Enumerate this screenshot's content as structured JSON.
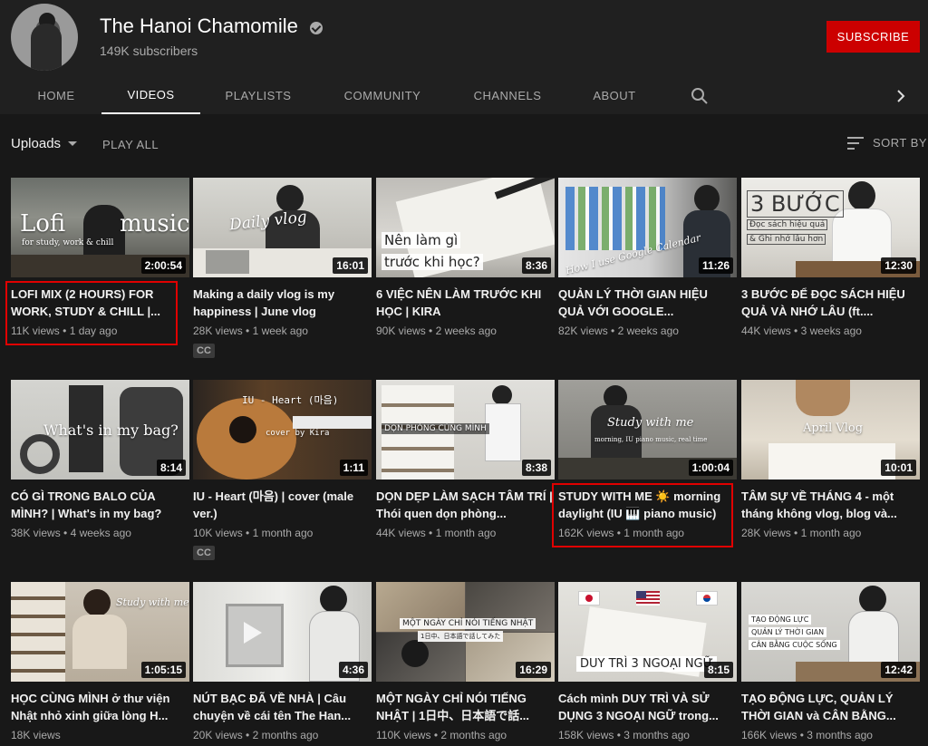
{
  "channel": {
    "name": "The Hanoi Chamomile",
    "subscribers": "149K subscribers",
    "subscribe_label": "SUBSCRIBE"
  },
  "tabs": [
    {
      "label": "HOME",
      "active": false
    },
    {
      "label": "VIDEOS",
      "active": true
    },
    {
      "label": "PLAYLISTS",
      "active": false
    },
    {
      "label": "COMMUNITY",
      "active": false
    },
    {
      "label": "CHANNELS",
      "active": false
    },
    {
      "label": "ABOUT",
      "active": false
    }
  ],
  "toolbar": {
    "uploads_label": "Uploads",
    "play_all_label": "PLAY ALL",
    "sort_label": "SORT BY"
  },
  "colors": {
    "subscribe_red": "#cc0000",
    "highlight_red": "#e00000",
    "background": "#181818"
  },
  "thumb_texts": {
    "v0": [
      "Lofi",
      "music",
      "for study, work & chill"
    ],
    "v1": [
      "Daily vlog"
    ],
    "v2": [
      "Nên làm gì",
      "trước khi học?"
    ],
    "v3": [
      "How I use Google Calendar"
    ],
    "v4": [
      "3 BƯỚC",
      "Đọc sách hiệu quả",
      "& Ghi nhớ lâu hơn"
    ],
    "v5": [
      "What's in my bag?"
    ],
    "v6": [
      "IU - Heart (마음)",
      "cover by Kira"
    ],
    "v7": [
      "DỌN PHÒNG CÙNG MÌNH"
    ],
    "v8": [
      "Study with me",
      "morning, IU piano music, real time"
    ],
    "v9": [
      "April Vlog"
    ],
    "v10": [
      "Study with me"
    ],
    "v11": [],
    "v12": [
      "MỘT NGÀY CHỈ NÓI TIẾNG NHẬT",
      "1日中、日本語で話してみた"
    ],
    "v13": [
      "DUY TRÌ 3 NGOẠI NGỮ"
    ],
    "v14": [
      "TẠO ĐỘNG LỰC",
      "QUẢN LÝ THỜI GIAN",
      "CÂN BẰNG CUỘC SỐNG"
    ]
  },
  "videos": [
    {
      "title": "LOFI MIX (2 HOURS) FOR WORK, STUDY & CHILL |...",
      "views": "11K views",
      "age": "1 day ago",
      "duration": "2:00:54",
      "cc": "",
      "highlighted": true
    },
    {
      "title": "Making a daily vlog is my happiness | June vlog",
      "views": "28K views",
      "age": "1 week ago",
      "duration": "16:01",
      "cc": "CC",
      "highlighted": false
    },
    {
      "title": "6 VIỆC NÊN LÀM TRƯỚC KHI HỌC | KIRA",
      "views": "90K views",
      "age": "2 weeks ago",
      "duration": "8:36",
      "cc": "",
      "highlighted": false
    },
    {
      "title": "QUẢN LÝ THỜI GIAN HIỆU QUẢ VỚI GOOGLE...",
      "views": "82K views",
      "age": "2 weeks ago",
      "duration": "11:26",
      "cc": "",
      "highlighted": false
    },
    {
      "title": "3 BƯỚC ĐỂ ĐỌC SÁCH HIỆU QUẢ VÀ NHỚ LÂU (ft....",
      "views": "44K views",
      "age": "3 weeks ago",
      "duration": "12:30",
      "cc": "",
      "highlighted": false
    },
    {
      "title": "CÓ GÌ TRONG BALO CỦA MÌNH? | What's in my bag?",
      "views": "38K views",
      "age": "4 weeks ago",
      "duration": "8:14",
      "cc": "",
      "highlighted": false
    },
    {
      "title": "IU - Heart (마음) | cover (male ver.)",
      "views": "10K views",
      "age": "1 month ago",
      "duration": "1:11",
      "cc": "CC",
      "highlighted": false
    },
    {
      "title": "DỌN DẸP LÀM SẠCH TÂM TRÍ | Thói quen dọn phòng...",
      "views": "44K views",
      "age": "1 month ago",
      "duration": "8:38",
      "cc": "",
      "highlighted": false
    },
    {
      "title": "STUDY WITH ME ☀️ morning daylight (IU 🎹 piano music)",
      "views": "162K views",
      "age": "1 month ago",
      "duration": "1:00:04",
      "cc": "",
      "highlighted": true
    },
    {
      "title": "TÂM SỰ VỀ THÁNG 4 - một tháng không vlog, blog và...",
      "views": "28K views",
      "age": "1 month ago",
      "duration": "10:01",
      "cc": "",
      "highlighted": false
    },
    {
      "title": "HỌC CÙNG MÌNH ở thư viện Nhật nhỏ xinh giữa lòng H...",
      "views": "18K views",
      "age": "",
      "duration": "1:05:15",
      "cc": "",
      "highlighted": false
    },
    {
      "title": "NÚT BẠC ĐÃ VỀ NHÀ | Câu chuyện về cái tên The Han...",
      "views": "20K views",
      "age": "2 months ago",
      "duration": "4:36",
      "cc": "",
      "highlighted": false
    },
    {
      "title": "MỘT NGÀY CHỈ NÓI TIẾNG NHẬT | 1日中、日本語で話...",
      "views": "110K views",
      "age": "2 months ago",
      "duration": "16:29",
      "cc": "",
      "highlighted": false
    },
    {
      "title": "Cách mình DUY TRÌ VÀ SỬ DỤNG 3 NGOẠI NGỮ trong...",
      "views": "158K views",
      "age": "3 months ago",
      "duration": "8:15",
      "cc": "",
      "highlighted": false
    },
    {
      "title": "TẠO ĐỘNG LỰC, QUẢN LÝ THỜI GIAN và CÂN BẰNG...",
      "views": "166K views",
      "age": "3 months ago",
      "duration": "12:42",
      "cc": "",
      "highlighted": false
    }
  ]
}
